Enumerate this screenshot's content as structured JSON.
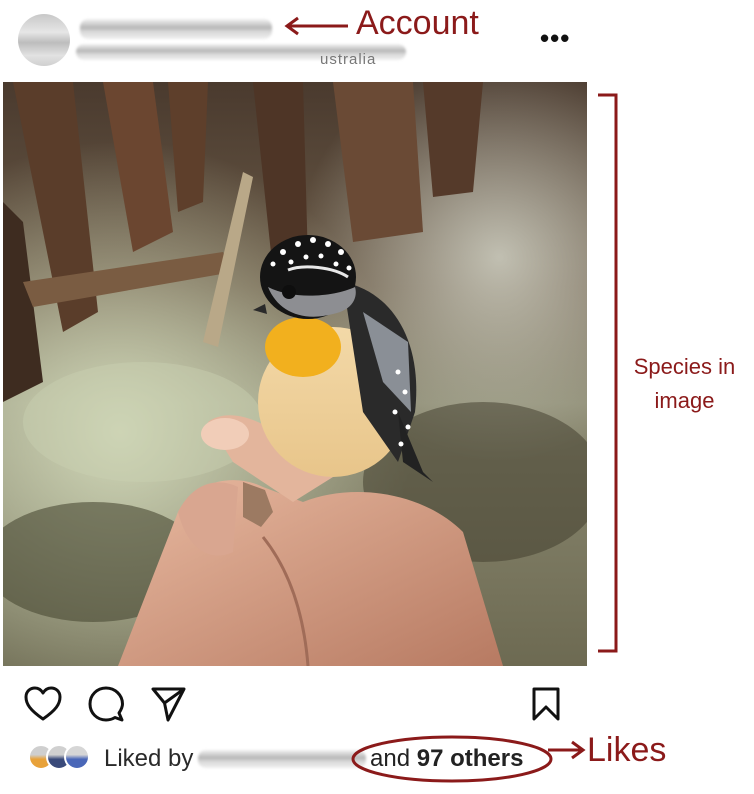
{
  "post": {
    "header": {
      "username": "",
      "location_fragment": "ustralia",
      "more_label": "•••"
    },
    "photo": {
      "subject": "spotted-pardalote-in-hand"
    },
    "actions": {
      "icons": [
        "heart-icon",
        "comment-icon",
        "share-icon",
        "bookmark-icon"
      ]
    },
    "likes": {
      "liked_by_label": "Liked by",
      "and_label": "and",
      "count_label": "97 others"
    }
  },
  "annotations": {
    "account": "Account",
    "species_line1": "Species in",
    "species_line2": "image",
    "likes": "Likes",
    "color": "#8b1a1a"
  }
}
